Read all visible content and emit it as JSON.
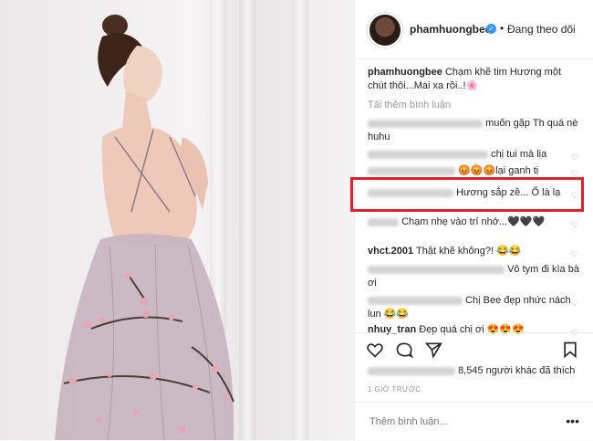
{
  "header": {
    "username": "phamhuongbee",
    "separator": "•",
    "follow_label": "Đang theo dõi"
  },
  "caption": {
    "username": "phamhuongbee",
    "text": "Chạm khẽ tim Hương một chút thôi...Mai xa rồi..!🌸"
  },
  "load_more_label": "Tải thêm bình luận",
  "comments": [
    {
      "user": "",
      "text": "muốn gặp Th quá nè huhu"
    },
    {
      "user": "",
      "text": "chị tui mà lịa"
    },
    {
      "user": "",
      "text": "😡😡😡lại ganh tị"
    },
    {
      "user": "",
      "text": "Hương sắp zề... Ổ là lạ"
    },
    {
      "user": "",
      "text": "Chạm nhẹ vào trí nhớ...🖤🖤🖤"
    },
    {
      "user": "vhct.2001",
      "text": "Thật khẽ không?! 😂😂"
    },
    {
      "user": "",
      "text": "Vô tym đi kìa bà ơi"
    },
    {
      "user": "",
      "text": "Chị Bee đẹp nhức nách lun 😂😂"
    },
    {
      "user": "nhuy_tran",
      "text": "Đẹp quá chị ơi 😍😍😍"
    }
  ],
  "likes": {
    "count_text": "8,545 người khác đã thích"
  },
  "timestamp": "1 GIỜ TRƯỚC",
  "add_comment": {
    "placeholder": "Thêm bình luận..."
  },
  "more_icon": "more-icon",
  "colors": {
    "highlight": "#e0202a",
    "verified": "#3897f0"
  }
}
